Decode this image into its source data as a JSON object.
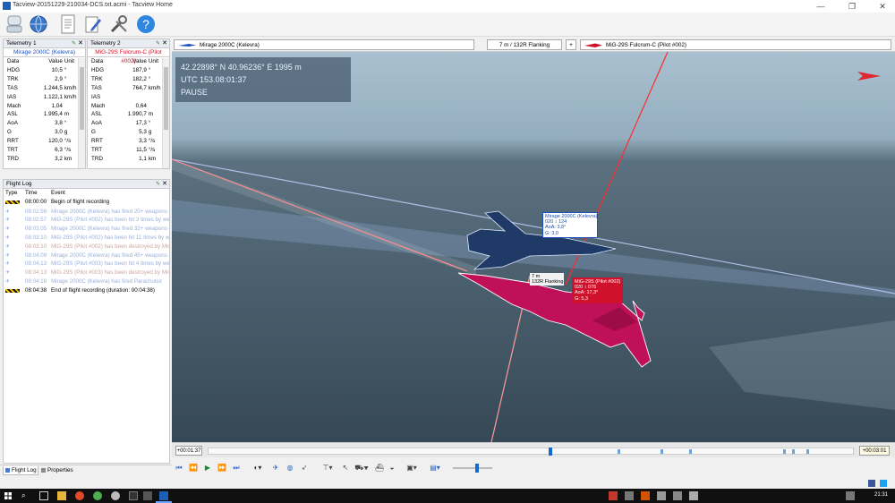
{
  "window": {
    "title": "Tacview-20151229-210034-DCS.txt.acmi - Tacview Home",
    "minimize": "—",
    "maximize": "❐",
    "close": "✕"
  },
  "toolbar": {
    "icons": [
      "user-icon",
      "globe-icon",
      "document-icon",
      "edit-icon",
      "tools-icon",
      "help-icon"
    ]
  },
  "telemetry1": {
    "title": "Telemetry 1",
    "subject": "Mirage 2000C (Kelevra)",
    "subject_color": "#1d4fb8",
    "headers": [
      "Data",
      "Value",
      "Unit"
    ],
    "rows": [
      [
        "HDG",
        "10,5",
        "°"
      ],
      [
        "TRK",
        "2,9",
        "°"
      ],
      [
        "TAS",
        "1.244,5",
        "km/h"
      ],
      [
        "IAS",
        "1.122,1",
        "km/h"
      ],
      [
        "Mach",
        "1,04",
        ""
      ],
      [
        "ASL",
        "1.995,4",
        "m"
      ],
      [
        "AoA",
        "3,8",
        "°"
      ],
      [
        "G",
        "3,0",
        "g"
      ],
      [
        "RRT",
        "120,0",
        "°/s"
      ],
      [
        "TRT",
        "6,3",
        "°/s"
      ],
      [
        "TRD",
        "3,2",
        "km"
      ]
    ]
  },
  "telemetry2": {
    "title": "Telemetry 2",
    "subject": "MiG-29S Fulcrum-C (Pilot #002)",
    "subject_color": "#d0112b",
    "headers": [
      "Data",
      "Value",
      "Unit"
    ],
    "rows": [
      [
        "HDG",
        "187,9",
        "°"
      ],
      [
        "TRK",
        "182,2",
        "°"
      ],
      [
        "TAS",
        "764,7",
        "km/h"
      ],
      [
        "IAS",
        "",
        ""
      ],
      [
        "Mach",
        "0,64",
        ""
      ],
      [
        "ASL",
        "1.990,7",
        "m"
      ],
      [
        "AoA",
        "17,3",
        "°"
      ],
      [
        "G",
        "5,3",
        "g"
      ],
      [
        "RRT",
        "3,3",
        "°/s"
      ],
      [
        "TRT",
        "11,5",
        "°/s"
      ],
      [
        "TRD",
        "1,1",
        "km"
      ]
    ]
  },
  "flightlog": {
    "title": "Flight Log",
    "headers": [
      "Type",
      "Time",
      "Event"
    ],
    "rows": [
      {
        "type": "hazard",
        "time": "08:00:00",
        "event": "Begin of flight recording",
        "color": "#000000"
      },
      {
        "type": "jet",
        "time": "08:02:56",
        "event": "Mirage 2000C (Kelevra) has fired 20+ weapons of",
        "color": "#9cb0da"
      },
      {
        "type": "jet",
        "time": "08:02:57",
        "event": "MiG-29S (Pilot #002) has been hit 3 times by we",
        "color": "#9cb0da"
      },
      {
        "type": "jet",
        "time": "08:03:05",
        "event": "Mirage 2000C (Kelevra) has fired 32+ weapons of",
        "color": "#9cb0da"
      },
      {
        "type": "jet",
        "time": "08:03:10",
        "event": "MiG-29S (Pilot #002) has been hit 11 times by we",
        "color": "#9cb0da"
      },
      {
        "type": "jet",
        "time": "08:03:10",
        "event": "MiG-29S (Pilot #002) has been destroyed by Mira",
        "color": "#c9a7a0"
      },
      {
        "type": "jet",
        "time": "08:04:09",
        "event": "Mirage 2000C (Kelevra) has fired 45+ weapons of",
        "color": "#9cb0da"
      },
      {
        "type": "jet",
        "time": "08:04:13",
        "event": "MiG-29S (Pilot #003) has been hit 4 times by we",
        "color": "#9cb0da"
      },
      {
        "type": "jet",
        "time": "08:04:13",
        "event": "MiG-29S (Pilot #003) has been destroyed by Mira",
        "color": "#c9a7a0"
      },
      {
        "type": "jet",
        "time": "08:04:18",
        "event": "Mirage 2000C (Kelevra) has fired Parachutist",
        "color": "#9cb0da"
      },
      {
        "type": "hazard",
        "time": "08:04:38",
        "event": "End of flight recording (duration: 00:04:38)",
        "color": "#000000"
      }
    ]
  },
  "bottom_tabs": [
    {
      "label": "Flight Log"
    },
    {
      "label": "Properties"
    }
  ],
  "viewport_header": {
    "left_object": "Mirage 2000C (Kelevra)",
    "center": "7 m / 132R Flanking",
    "plus": "+",
    "right_object": "MiG-29S Fulcrum-C (Pilot #002)"
  },
  "viewport": {
    "coords": "42.22898° N  40.96236° E  1995 m",
    "utc": "UTC 153.08:01:37",
    "state": "PAUSE",
    "mirage_label": [
      "Mirage 2000C (Kelevra)",
      "020 ↕ 124",
      "AoA: 3,8°",
      "G: 3,0"
    ],
    "mig_label": [
      "MiG-29S (Pilot #002)",
      "020 ↕ 076",
      "AoA: 17,3°",
      "G: 5,3"
    ],
    "range_label": [
      "7 m",
      "132R Flanking"
    ],
    "colors": {
      "mirage": "#1f3a66",
      "mig": "#c01058",
      "sky": "#a8c0cf",
      "ground": "#4a5f6e"
    }
  },
  "timeline": {
    "current": "+00:01:37",
    "end": "+00:03:01",
    "progress": 0.53
  },
  "taskbar": {
    "time": "21:31"
  }
}
